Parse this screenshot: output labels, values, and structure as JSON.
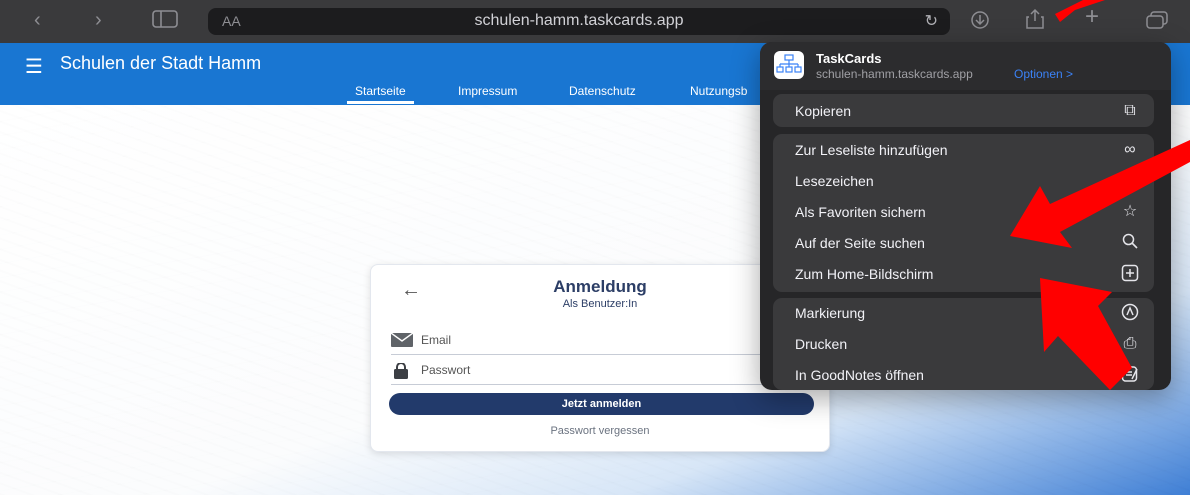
{
  "browser": {
    "url": "schulen-hamm.taskcards.app",
    "aa_label": "AA"
  },
  "app": {
    "title": "Schulen der Stadt Hamm",
    "tabs": [
      {
        "label": "Startseite",
        "active": true
      },
      {
        "label": "Impressum",
        "active": false
      },
      {
        "label": "Datenschutz",
        "active": false
      },
      {
        "label": "Nutzungsb",
        "active": false
      }
    ],
    "brand_color": "#1976d2"
  },
  "login": {
    "title": "Anmeldung",
    "subtitle": "Als Benutzer:In",
    "email_label": "Email",
    "password_label": "Passwort",
    "submit_label": "Jetzt anmelden",
    "forgot_label": "Passwort vergessen",
    "button_color": "#223a6b"
  },
  "share": {
    "app_name": "TaskCards",
    "app_url": "schulen-hamm.taskcards.app",
    "options_label": "Optionen >",
    "copy": {
      "label": "Kopieren",
      "icon": "copy-icon"
    },
    "group1": [
      {
        "label": "Zur Leseliste hinzufügen",
        "icon": "glasses-icon"
      },
      {
        "label": "Lesezeichen",
        "icon": "book-icon"
      },
      {
        "label": "Als Favoriten sichern",
        "icon": "star-icon"
      },
      {
        "label": "Auf der Seite suchen",
        "icon": "search-icon"
      },
      {
        "label": "Zum Home-Bildschirm",
        "icon": "plus-square-icon"
      }
    ],
    "group2": [
      {
        "label": "Markierung",
        "icon": "markup-icon"
      },
      {
        "label": "Drucken",
        "icon": "print-icon"
      },
      {
        "label": "In GoodNotes öffnen",
        "icon": "goodnotes-icon"
      }
    ]
  },
  "annotation_color": "#ff0000"
}
